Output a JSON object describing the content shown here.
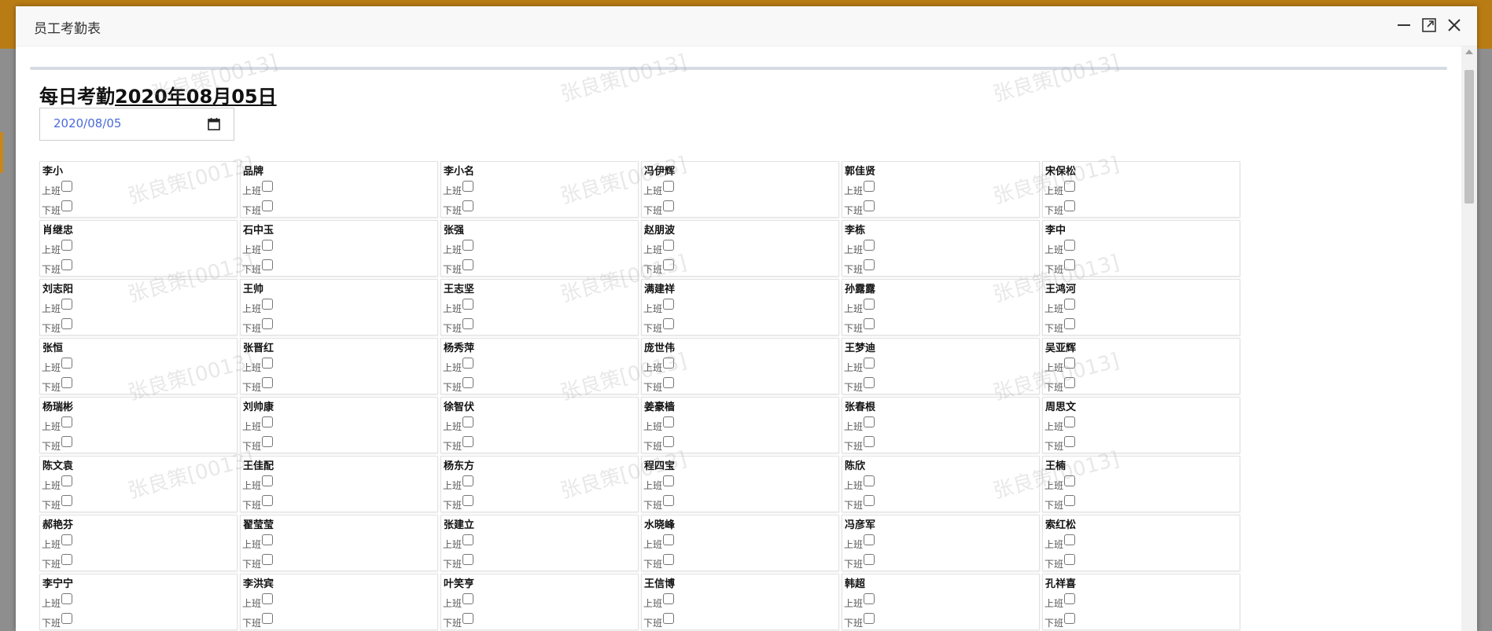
{
  "dialog": {
    "title": "员工考勤表"
  },
  "icons": {
    "minimize": "minimize-icon",
    "maximize": "maximize-icon",
    "close": "close-icon",
    "calendar": "calendar-icon"
  },
  "colors": {
    "accent_bar": "#b97c14",
    "date_text": "#4a6bd8",
    "heading": "#111111"
  },
  "page": {
    "heading_prefix": "每日考勤",
    "heading_date": "2020年08月05日",
    "date_input_value": "2020/08/05",
    "on_duty_label": "上班",
    "off_duty_label": "下班",
    "watermark": "张良策[0013]"
  },
  "employees": [
    "李小",
    "品牌",
    "李小名",
    "冯伊辉",
    "郭佳贤",
    "宋保松",
    "肖继忠",
    "石中玉",
    "张强",
    "赵朋波",
    "李栋",
    "李中",
    "刘志阳",
    "王帅",
    "王志坚",
    "满建祥",
    "孙露露",
    "王鸿河",
    "张恒",
    "张晋红",
    "杨秀萍",
    "庞世伟",
    "王梦迪",
    "吴亚辉",
    "杨瑞彬",
    "刘帅康",
    "徐智伏",
    "姜豪樯",
    "张春根",
    "周思文",
    "陈文袁",
    "王佳配",
    "杨东方",
    "程四宝",
    "陈欣",
    "王楠",
    "郝艳芬",
    "翟莹莹",
    "张建立",
    "水晓峰",
    "冯彦军",
    "索红松",
    "李宁宁",
    "李洪宾",
    "叶笑亨",
    "王信博",
    "韩超",
    "孔祥喜"
  ]
}
